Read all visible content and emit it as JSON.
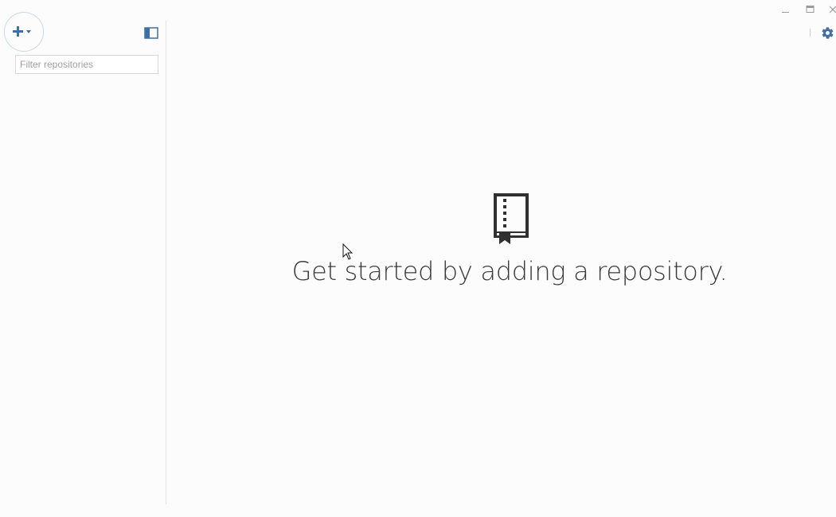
{
  "sidebar": {
    "filter": {
      "placeholder": "Filter repositories",
      "value": ""
    },
    "add_button_icon": "plus-icon",
    "add_button_caret": "caret-down-icon",
    "toggle_icon": "sidebar-toggle-icon"
  },
  "window_controls": {
    "minimize_icon": "minimize-icon",
    "maximize_icon": "maximize-icon",
    "close_icon": "close-icon",
    "settings_icon": "gear-icon"
  },
  "main": {
    "empty_state": {
      "icon": "repo-book-icon",
      "message": "Get started by adding a repository."
    }
  },
  "colors": {
    "accent": "#3d6fa8",
    "background": "#fcfcfc",
    "text": "#3a3a3a"
  }
}
